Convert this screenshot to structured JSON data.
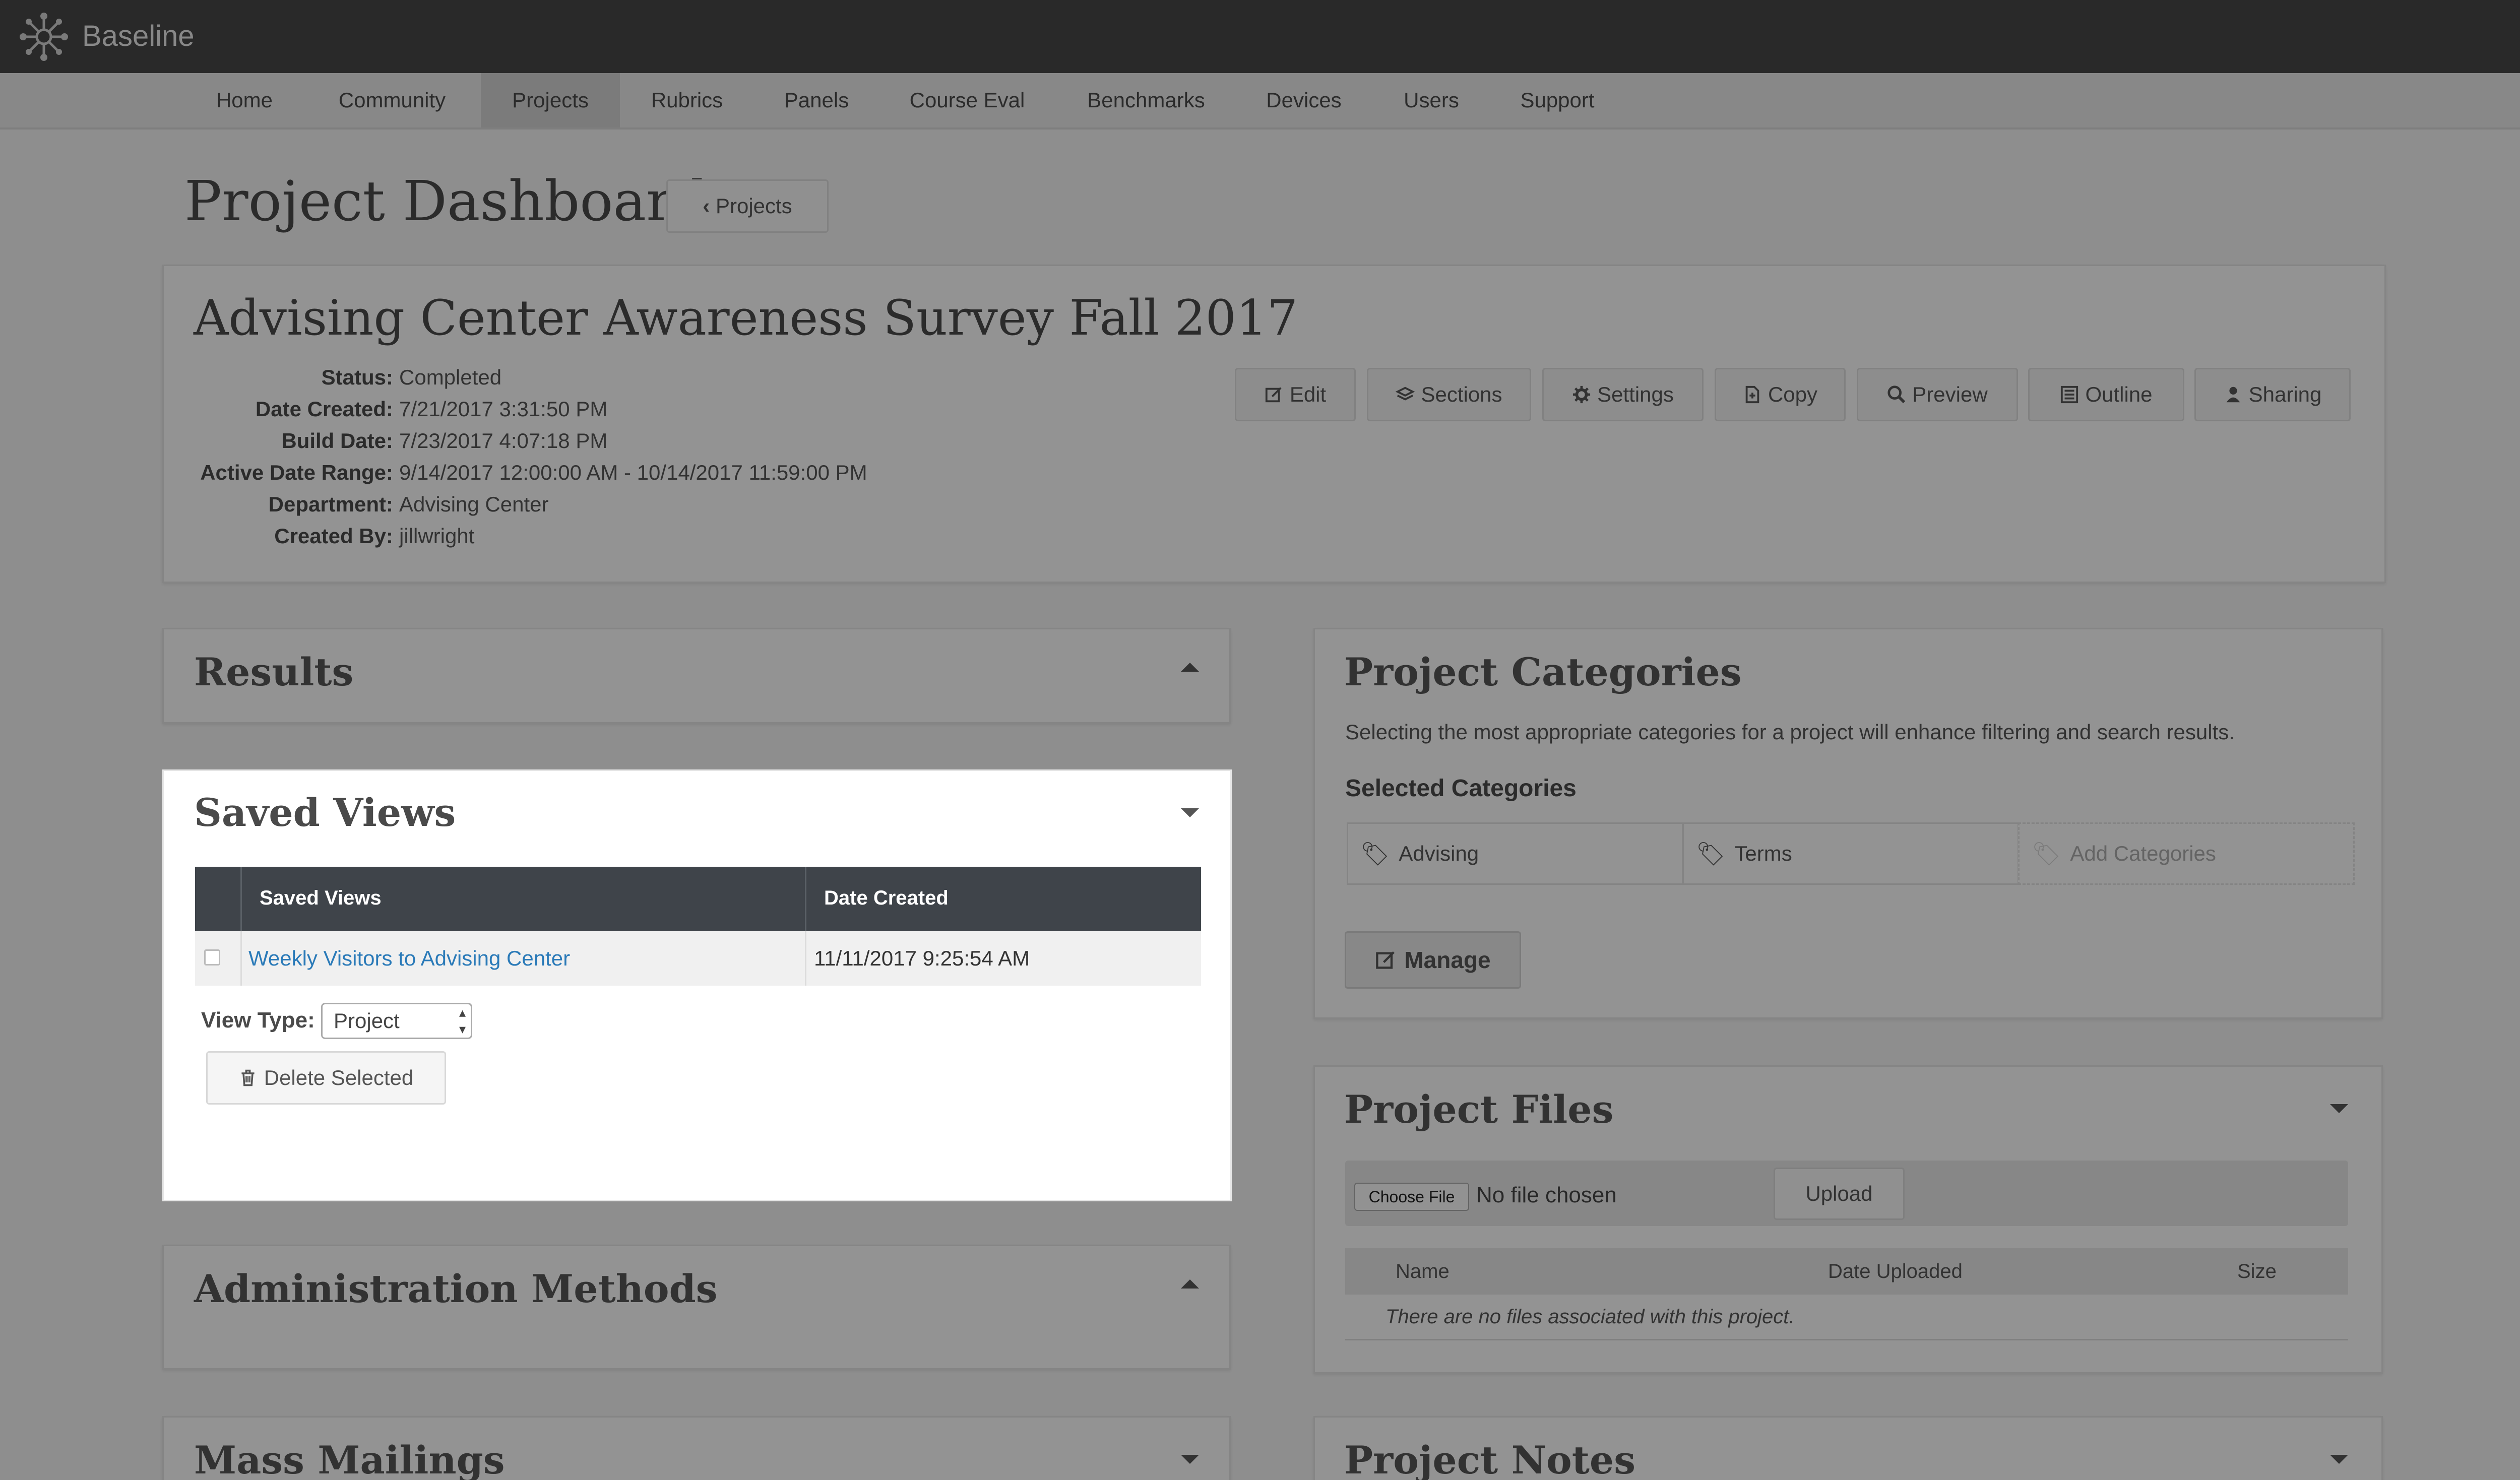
{
  "app": {
    "name": "Baseline"
  },
  "nav": {
    "items": [
      {
        "label": "Home"
      },
      {
        "label": "Community"
      },
      {
        "label": "Projects"
      },
      {
        "label": "Rubrics"
      },
      {
        "label": "Panels"
      },
      {
        "label": "Course Eval"
      },
      {
        "label": "Benchmarks"
      },
      {
        "label": "Devices"
      },
      {
        "label": "Users"
      },
      {
        "label": "Support"
      }
    ],
    "active": "Projects"
  },
  "page": {
    "title": "Project Dashboard",
    "back_label": "Projects"
  },
  "project": {
    "name": "Advising Center Awareness Survey Fall 2017",
    "fields": [
      {
        "label": "Status:",
        "value": "Completed"
      },
      {
        "label": "Date Created:",
        "value": "7/21/2017 3:31:50 PM"
      },
      {
        "label": "Build Date:",
        "value": "7/23/2017 4:07:18 PM"
      },
      {
        "label": "Active Date Range:",
        "value": "9/14/2017 12:00:00 AM - 10/14/2017 11:59:00 PM"
      },
      {
        "label": "Department:",
        "value": "Advising Center"
      },
      {
        "label": "Created By:",
        "value": "jillwright"
      }
    ],
    "toolbar": [
      "Edit",
      "Sections",
      "Settings",
      "Copy",
      "Preview",
      "Outline",
      "Sharing"
    ]
  },
  "results": {
    "title": "Results"
  },
  "saved_views": {
    "title": "Saved Views",
    "columns": [
      "Saved Views",
      "Date Created"
    ],
    "rows": [
      {
        "name": "Weekly Visitors to Advising Center",
        "date": "11/11/2017 9:25:54 AM"
      }
    ],
    "view_type_label": "View Type:",
    "view_type_value": "Project",
    "delete_label": "Delete Selected"
  },
  "admin_methods": {
    "title": "Administration Methods"
  },
  "mass_mailings": {
    "title": "Mass Mailings"
  },
  "categories": {
    "title": "Project Categories",
    "description": "Selecting the most appropriate categories for a project will enhance filtering and search results.",
    "selected_label": "Selected Categories",
    "items": [
      "Advising",
      "Terms"
    ],
    "add_label": "Add Categories",
    "manage_label": "Manage"
  },
  "files": {
    "title": "Project Files",
    "choose_label": "Choose File",
    "no_file": "No file chosen",
    "upload_label": "Upload",
    "columns": [
      "Name",
      "Date Uploaded",
      "Size"
    ],
    "empty": "There are no files associated with this project."
  },
  "notes": {
    "title": "Project Notes"
  }
}
